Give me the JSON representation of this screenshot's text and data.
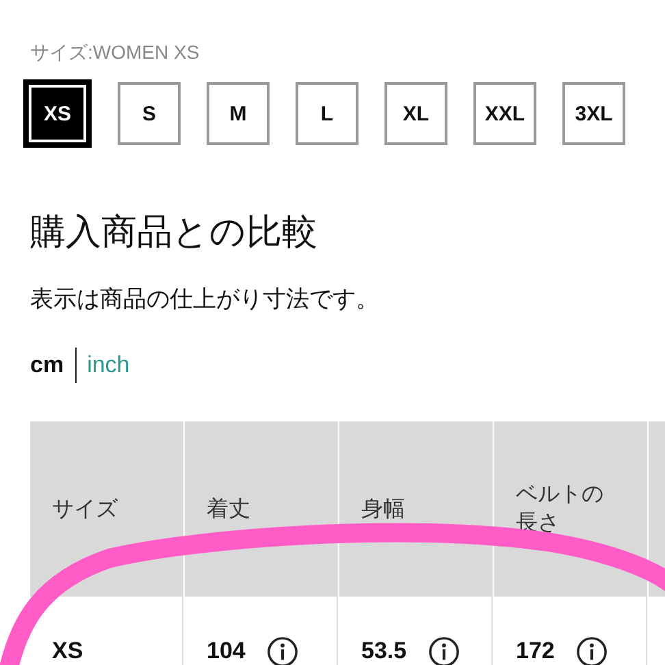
{
  "size_label": "サイズ:WOMEN XS",
  "sizes": [
    {
      "label": "XS",
      "selected": true
    },
    {
      "label": "S",
      "selected": false
    },
    {
      "label": "M",
      "selected": false
    },
    {
      "label": "L",
      "selected": false
    },
    {
      "label": "XL",
      "selected": false
    },
    {
      "label": "XXL",
      "selected": false
    },
    {
      "label": "3XL",
      "selected": false
    }
  ],
  "heading": "購入商品との比較",
  "note": "表示は商品の仕上がり寸法です。",
  "units": [
    {
      "label": "cm",
      "selected": true
    },
    {
      "label": "inch",
      "selected": false
    }
  ],
  "table": {
    "columns": [
      "サイズ",
      "着丈",
      "身幅",
      "ベルトの長さ"
    ],
    "rows": [
      {
        "size": "XS",
        "values": [
          "104",
          "53.5",
          "172"
        ]
      }
    ]
  },
  "annotation": {
    "kind": "freehand-loop"
  }
}
